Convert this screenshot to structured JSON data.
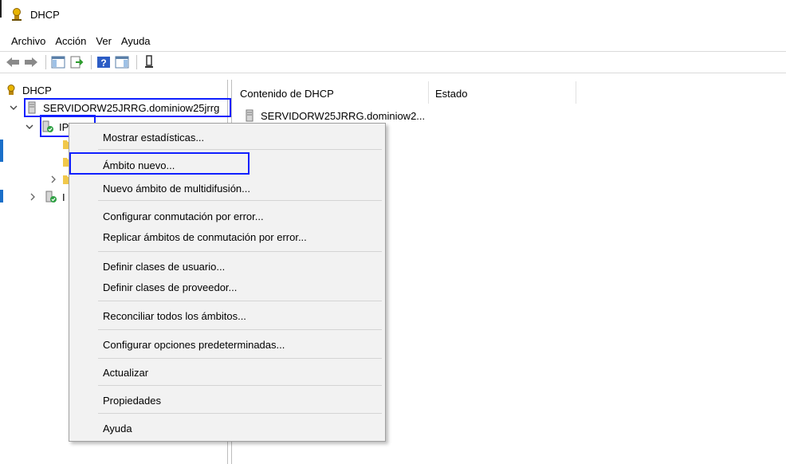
{
  "window": {
    "title": "DHCP"
  },
  "menubar": [
    "Archivo",
    "Acción",
    "Ver",
    "Ayuda"
  ],
  "toolbar": {
    "buttons": [
      "back-icon",
      "forward-icon",
      "show-hide-tree-icon",
      "export-list-icon",
      "help-icon",
      "show-hide-action-pane-icon",
      "filter-icon"
    ]
  },
  "tree": {
    "root": "DHCP",
    "server": "SERVIDORW25JRRG.dominiow25jrrg",
    "ipv4_visible": "IPv4",
    "ipv6_visible": "I"
  },
  "content": {
    "columns": [
      "Contenido de DHCP",
      "Estado"
    ],
    "rows": [
      {
        "name": "SERVIDORW25JRRG.dominiow2...",
        "status": ""
      }
    ]
  },
  "context_menu": {
    "groups": [
      [
        "Mostrar estadísticas..."
      ],
      [
        "Ámbito nuevo...",
        "Nuevo ámbito de multidifusión..."
      ],
      [
        "Configurar conmutación por error...",
        "Replicar ámbitos de conmutación por error..."
      ],
      [
        "Definir clases de usuario...",
        "Definir clases de proveedor..."
      ],
      [
        "Reconciliar todos los ámbitos..."
      ],
      [
        "Configurar opciones predeterminadas..."
      ],
      [
        "Actualizar"
      ],
      [
        "Propiedades"
      ],
      [
        "Ayuda"
      ]
    ]
  },
  "colors": {
    "highlight_border": "#1020ff",
    "menu_bg": "#f2f2f2"
  }
}
